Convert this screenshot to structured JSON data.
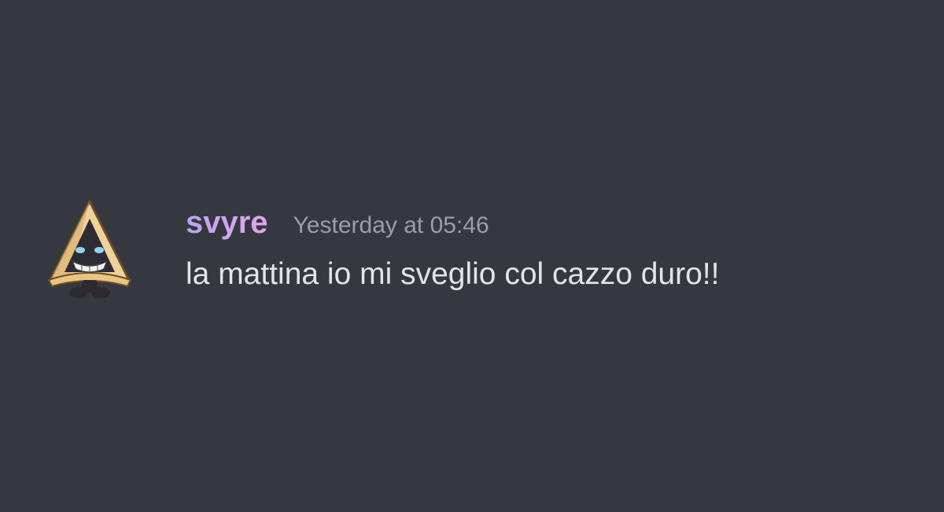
{
  "message": {
    "author": "svyre",
    "timestamp": "Yesterday at 05:46",
    "text": "la mattina io mi sveglio col cazzo duro!!",
    "avatar_icon": "snorunt-avatar-icon"
  },
  "colors": {
    "background": "#36383f",
    "username_gradient_start": "#b7a4f2",
    "username_gradient_end": "#e6a5ec",
    "timestamp": "#9c9ea6",
    "message_text": "#e2e4e8"
  }
}
